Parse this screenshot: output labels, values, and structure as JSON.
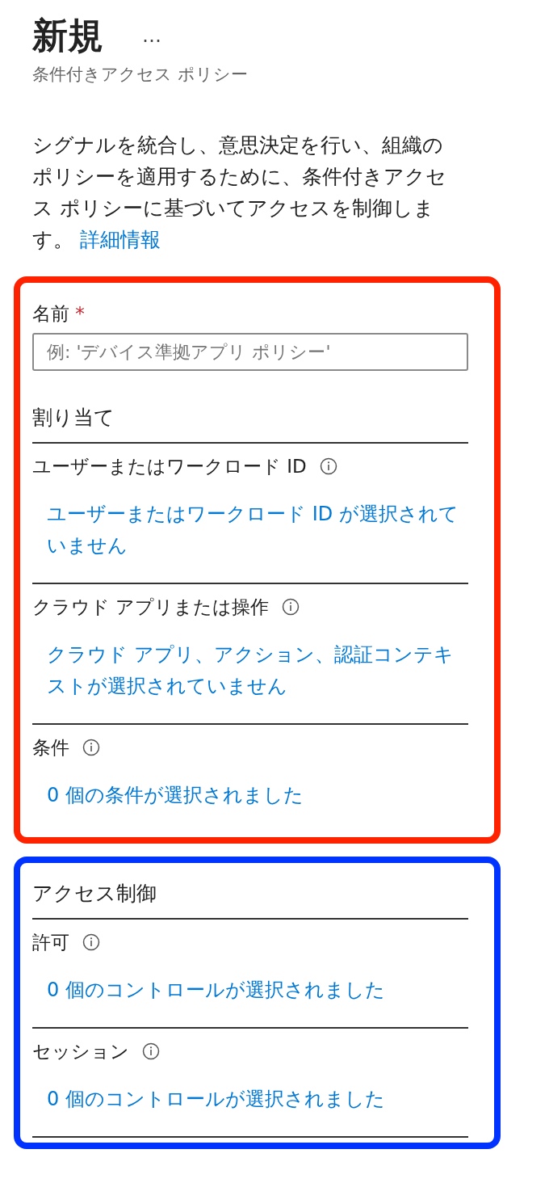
{
  "header": {
    "title": "新規",
    "more": "…",
    "subtitle": "条件付きアクセス ポリシー"
  },
  "description": {
    "text": "シグナルを統合し、意思決定を行い、組織のポリシーを適用するために、条件付きアクセス ポリシーに基づいてアクセスを制御します。",
    "link": "詳細情報"
  },
  "sections": [
    {
      "color": "#ff2200",
      "items": [
        {
          "kind": "field",
          "label": "名前",
          "required_mark": "*",
          "placeholder": "例: 'デバイス準拠アプリ ポリシー'"
        },
        {
          "kind": "heading",
          "label": "割り当て",
          "divider": true
        },
        {
          "kind": "setting",
          "label": "ユーザーまたはワークロード ID",
          "info": true,
          "link": "ユーザーまたはワークロード ID が選択されていません",
          "divider": true
        },
        {
          "kind": "setting",
          "label": "クラウド アプリまたは操作",
          "info": true,
          "link": "クラウド アプリ、アクション、認証コンテキストが選択されていません",
          "divider": true
        },
        {
          "kind": "setting",
          "label": "条件",
          "info": true,
          "link": "0 個の条件が選択されました",
          "divider": false
        }
      ]
    },
    {
      "color": "#0033ff",
      "items": [
        {
          "kind": "heading",
          "label": "アクセス制御",
          "divider": true
        },
        {
          "kind": "setting",
          "label": "許可",
          "info": true,
          "link": "0 個のコントロールが選択されました",
          "divider": true
        },
        {
          "kind": "setting",
          "label": "セッション",
          "info": true,
          "link": "0 個のコントロールが選択されました",
          "divider": true
        }
      ]
    }
  ]
}
